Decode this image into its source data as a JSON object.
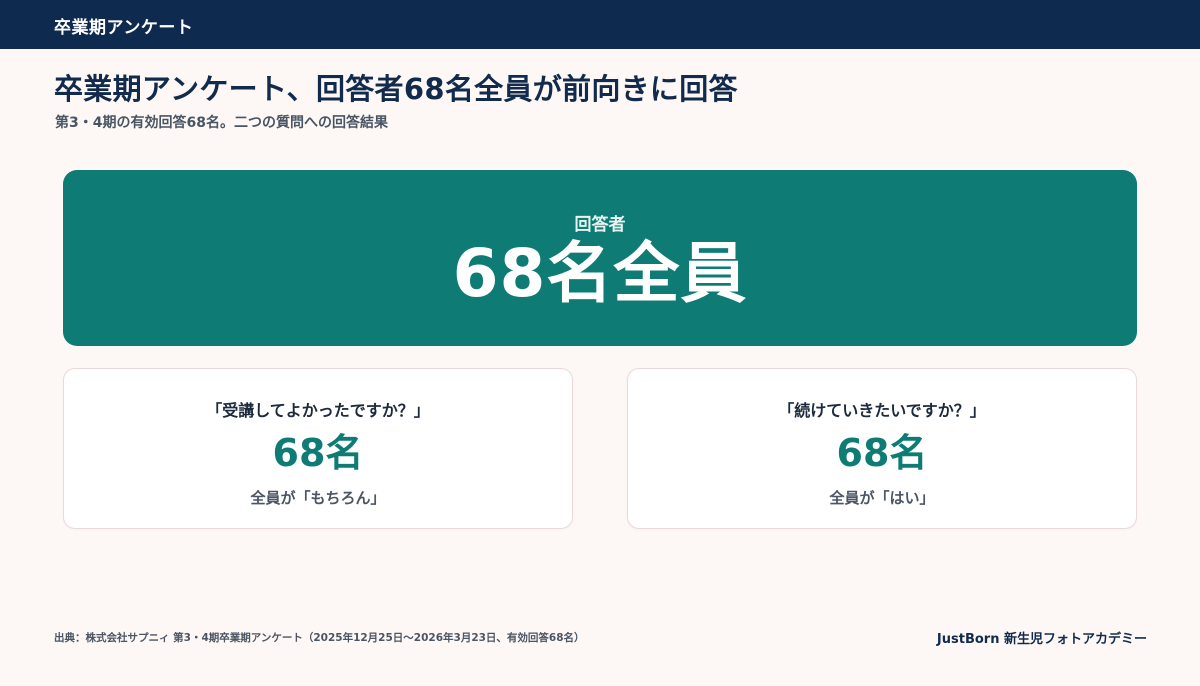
{
  "header": {
    "title": "卒業期アンケート"
  },
  "page": {
    "title": "卒業期アンケート、回答者68名全員が前向きに回答",
    "subtitle": "第3・4期の有効回答68名。二つの質問への回答結果"
  },
  "hero": {
    "label": "回答者",
    "value": "68名全員"
  },
  "cards": [
    {
      "question": "「受講してよかったですか？」",
      "value": "68名",
      "answer": "全員が「もちろん」"
    },
    {
      "question": "「続けていきたいですか？」",
      "value": "68名",
      "answer": "全員が「はい」"
    }
  ],
  "footer": {
    "source": "出典：株式会社サプニィ 第3・4期卒業期アンケート（2025年12月25日〜2026年3月23日、有効回答68名）",
    "brand": "JustBorn 新生児フォトアカデミー"
  },
  "colors": {
    "header_bg": "#0e2a4f",
    "accent_teal": "#0e7c74",
    "background": "#fdf8f5"
  }
}
